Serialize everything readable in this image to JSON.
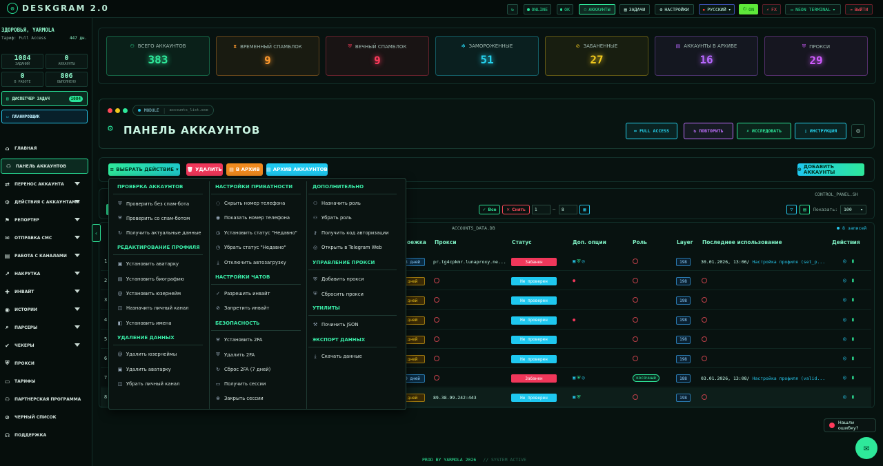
{
  "app": {
    "title": "DESKGRAM 2.0"
  },
  "topbar": {
    "refresh_icon": "refresh-icon",
    "online": "ONLINE",
    "ok": "OK",
    "accounts": "АККАУНТЫ",
    "tasks": "ЗАДАЧИ",
    "settings": "НАСТРОЙКИ",
    "language": "РУССКИЙ",
    "on": "ON",
    "fx": "FX",
    "theme": "NEON TERMINAL",
    "logout": "ВЫЙТИ"
  },
  "sidebar": {
    "greeting": "ЗДОРОВЬЯ, YARMOLA",
    "plan": "Тариф: Full Access",
    "days": "447 дн.",
    "stats": [
      {
        "value": "1084",
        "label": "ЗАДАНИЙ"
      },
      {
        "value": "0",
        "label": "АККАУНТЫ"
      },
      {
        "value": "0",
        "label": "В РАБОТЕ"
      },
      {
        "value": "806",
        "label": "ВЫПОЛНЕНО"
      }
    ],
    "dispatcher": "ДИСПЕТЧЕР ЗАДАЧ",
    "dispatcher_count": "1084",
    "planner": "ПЛАНИРОВЩИК",
    "nav": [
      {
        "label": "ГЛАВНАЯ",
        "icon": "home-icon",
        "glyph": "⌂"
      },
      {
        "label": "ПАНЕЛЬ АККАУНТОВ",
        "icon": "users-icon",
        "glyph": "⚇"
      },
      {
        "label": "ПЕРЕНОС АККАУНТА",
        "icon": "transfer-icon",
        "glyph": "⇄"
      },
      {
        "label": "ДЕЙСТВИЯ С АККАУНТАМИ",
        "icon": "user-gear-icon",
        "glyph": "⚙"
      },
      {
        "label": "РЕПОРТЕР",
        "icon": "flag-icon",
        "glyph": "⚑"
      },
      {
        "label": "ОТПРАВКА СМС",
        "icon": "chat-icon",
        "glyph": "✉"
      },
      {
        "label": "РАБОТА С КАНАЛАМИ",
        "icon": "channel-icon",
        "glyph": "▤"
      },
      {
        "label": "НАКРУТКА",
        "icon": "chart-icon",
        "glyph": "↗"
      },
      {
        "label": "ИНВАЙТ",
        "icon": "invite-icon",
        "glyph": "✚"
      },
      {
        "label": "ИСТОРИИ",
        "icon": "stories-icon",
        "glyph": "◉"
      },
      {
        "label": "ПАРСЕРЫ",
        "icon": "search-icon",
        "glyph": "⌕"
      },
      {
        "label": "ЧЕКЕРЫ",
        "icon": "check-icon",
        "glyph": "✔"
      },
      {
        "label": "ПРОКСИ",
        "icon": "shield-icon",
        "glyph": "⛨"
      },
      {
        "label": "ТАРИФЫ",
        "icon": "card-icon",
        "glyph": "▭"
      },
      {
        "label": "ПАРТНЕРСКАЯ ПРОГРАММА",
        "icon": "partner-icon",
        "glyph": "⚇"
      },
      {
        "label": "ЧЕРНЫЙ СПИСОК",
        "icon": "blacklist-icon",
        "glyph": "⊘"
      },
      {
        "label": "ПОДДЕРЖКА",
        "icon": "headset-icon",
        "glyph": "☊"
      }
    ]
  },
  "stats_cards": [
    {
      "label": "ВСЕГО АККАУНТОВ",
      "value": "383",
      "color": "#2ee89a",
      "icon": "users-icon",
      "glyph": "⚇"
    },
    {
      "label": "ВРЕМЕННЫЙ СПАМБЛОК",
      "value": "9",
      "color": "#ff9a2e",
      "icon": "hourglass-icon",
      "glyph": "⧗"
    },
    {
      "label": "ВЕЧНЫЙ СПАМБЛОК",
      "value": "9",
      "color": "#ff3b5c",
      "icon": "shield-icon",
      "glyph": "⛨"
    },
    {
      "label": "ЗАМОРОЖЕННЫЕ",
      "value": "51",
      "color": "#26d4f0",
      "icon": "snowflake-icon",
      "glyph": "✻"
    },
    {
      "label": "ЗАБАНЕННЫЕ",
      "value": "27",
      "color": "#f0c81e",
      "icon": "ban-icon",
      "glyph": "⊘"
    },
    {
      "label": "АККАУНТЫ В АРХИВЕ",
      "value": "16",
      "color": "#b768ff",
      "icon": "archive-icon",
      "glyph": "▤"
    },
    {
      "label": "ПРОКСИ",
      "value": "29",
      "color": "#d05cff",
      "icon": "proxy-icon",
      "glyph": "⛨"
    }
  ],
  "panel": {
    "module_label": "MODULE",
    "module_file": "accounts_list.exe",
    "title": "ПАНЕЛЬ АККАУНТОВ",
    "buttons": [
      {
        "label": "FULL ACCESS",
        "color": "#26d4f0",
        "icon": "infinity-icon",
        "glyph": "∞"
      },
      {
        "label": "ПОВТОРИТЬ",
        "color": "#c070ff",
        "icon": "repeat-icon",
        "glyph": "↻"
      },
      {
        "label": "ИССЛЕДОВАТЬ",
        "color": "#2ee89a",
        "icon": "research-icon",
        "glyph": "⌕"
      },
      {
        "label": "ИНСТРУКЦИЯ",
        "color": "#26d4f0",
        "icon": "book-icon",
        "glyph": "▯"
      }
    ]
  },
  "actions": {
    "select_action": "ВЫБРАТЬ ДЕЙСТВИЕ",
    "delete": "УДАЛИТЬ",
    "to_archive": "В АРХИВ",
    "archive_accounts": "АРХИВ АККАУНТОВ",
    "add_accounts": "ДОБАВИТЬ АККАУНТЫ"
  },
  "control": {
    "file": "CONTROL_PANEL.SH",
    "all": "Все",
    "reset": "Снять",
    "from": "1",
    "to": "8",
    "show_label": "Показать:",
    "show_value": "100"
  },
  "table": {
    "file": "ACCOUNTS_DATA.DB",
    "records": "8 записей",
    "headers": [
      "оежка",
      "Прокси",
      "Статус",
      "Доп. опции",
      "Роль",
      "Layer",
      "Последнее использование",
      "Действия"
    ],
    "rows": [
      {
        "num": "1",
        "dd": "8 дней",
        "dd_color": "blue",
        "proxy": "pr.tg4cpkmr.lunaproxy.ne...",
        "status": "Забанен",
        "status_color": "#f0375a",
        "opts": "camera,shield,check",
        "role": "",
        "layer": "198",
        "last": "30.01.2026, 13:06/",
        "last_link": "Настройка профиля (set_p..."
      },
      {
        "num": "2",
        "dd": "дней",
        "dd_color": "orange",
        "proxy": "",
        "status": "Не проверен",
        "status_color": "#1ec8f0",
        "opts": "f",
        "role": "",
        "layer": "198",
        "last": "",
        "last_link": ""
      },
      {
        "num": "3",
        "dd": "дней",
        "dd_color": "orange",
        "proxy": "",
        "status": "Не проверен",
        "status_color": "#1ec8f0",
        "opts": "",
        "role": "",
        "layer": "198",
        "last": "",
        "last_link": ""
      },
      {
        "num": "4",
        "dd": "дней",
        "dd_color": "orange",
        "proxy": "",
        "status": "Не проверен",
        "status_color": "#1ec8f0",
        "opts": "f",
        "role": "",
        "layer": "198",
        "last": "",
        "last_link": ""
      },
      {
        "num": "5",
        "dd": "дней",
        "dd_color": "orange",
        "proxy": "",
        "status": "Не проверен",
        "status_color": "#1ec8f0",
        "opts": "",
        "role": "",
        "layer": "198",
        "last": "",
        "last_link": ""
      },
      {
        "num": "6",
        "dd": "дней",
        "dd_color": "orange",
        "proxy": "",
        "status": "Не проверен",
        "status_color": "#1ec8f0",
        "opts": "",
        "role": "",
        "layer": "198",
        "last": "",
        "last_link": ""
      },
      {
        "num": "7",
        "dd": "0 дней",
        "dd_color": "blue",
        "proxy": "",
        "status": "Забанен",
        "status_color": "#f0375a",
        "opts": "camera,shield,check",
        "role": "косячный",
        "layer": "188",
        "last": "03.01.2026, 13:08/",
        "last_link": "Настройка профиля (valid..."
      },
      {
        "num": "8",
        "dd": "дней",
        "dd_color": "orange",
        "proxy": "89.38.99.242:443",
        "status": "Не проверен",
        "status_color": "#1ec8f0",
        "opts": "camera,shield",
        "role": "",
        "layer": "198",
        "last": "",
        "last_link": ""
      }
    ]
  },
  "dropdown": {
    "columns": [
      [
        {
          "type": "header",
          "label": "ПРОВЕРКА АККАУНТОВ"
        },
        {
          "type": "item",
          "label": "Проверить без спам-бота",
          "glyph": "⛨"
        },
        {
          "type": "item",
          "label": "Проверить со спам-ботом",
          "glyph": "⛨"
        },
        {
          "type": "item",
          "label": "Получить актуальные данные",
          "glyph": "↻"
        },
        {
          "type": "header",
          "label": "РЕДАКТИРОВАНИЕ ПРОФИЛЯ"
        },
        {
          "type": "item",
          "label": "Установить аватарку",
          "glyph": "▣"
        },
        {
          "type": "item",
          "label": "Установить биографию",
          "glyph": "▤"
        },
        {
          "type": "item",
          "label": "Установить юзернейм",
          "glyph": "@"
        },
        {
          "type": "item",
          "label": "Назначить личный канал",
          "glyph": "◫"
        },
        {
          "type": "item",
          "label": "Установить имена",
          "glyph": "◧"
        },
        {
          "type": "header",
          "label": "УДАЛЕНИЕ ДАННЫХ"
        },
        {
          "type": "item",
          "label": "Удалить юзернеймы",
          "glyph": "@"
        },
        {
          "type": "item",
          "label": "Удалить аватарку",
          "glyph": "▣"
        },
        {
          "type": "item",
          "label": "Убрать личный канал",
          "glyph": "◫"
        }
      ],
      [
        {
          "type": "header",
          "label": "НАСТРОЙКИ ПРИВАТНОСТИ"
        },
        {
          "type": "item",
          "label": "Скрыть номер телефона",
          "glyph": "◌"
        },
        {
          "type": "item",
          "label": "Показать номер телефона",
          "glyph": "◉"
        },
        {
          "type": "item",
          "label": "Установить статус \"Недавно\"",
          "glyph": "◷"
        },
        {
          "type": "item",
          "label": "Убрать статус \"Недавно\"",
          "glyph": "◷"
        },
        {
          "type": "item",
          "label": "Отключить автозагрузку",
          "glyph": "⤓"
        },
        {
          "type": "header",
          "label": "НАСТРОЙКИ ЧАТОВ"
        },
        {
          "type": "item",
          "label": "Разрешить инвайт",
          "glyph": "✓"
        },
        {
          "type": "item",
          "label": "Запретить инвайт",
          "glyph": "⊘"
        },
        {
          "type": "header",
          "label": "БЕЗОПАСНОСТЬ"
        },
        {
          "type": "item",
          "label": "Установить 2FA",
          "glyph": "⛨"
        },
        {
          "type": "item",
          "label": "Удалить 2FA",
          "glyph": "⛨"
        },
        {
          "type": "item",
          "label": "Сброс 2FA (7 дней)",
          "glyph": "↻"
        },
        {
          "type": "item",
          "label": "Получить сессии",
          "glyph": "▭"
        },
        {
          "type": "item",
          "label": "Закрыть сессии",
          "glyph": "⊗"
        }
      ],
      [
        {
          "type": "header",
          "label": "ДОПОЛНИТЕЛЬНО"
        },
        {
          "type": "item",
          "label": "Назначить роль",
          "glyph": "⚇"
        },
        {
          "type": "item",
          "label": "Убрать роль",
          "glyph": "⚇"
        },
        {
          "type": "item",
          "label": "Получить код авторизации",
          "glyph": "⚷"
        },
        {
          "type": "item",
          "label": "Открыть в Telegram Web",
          "glyph": "◎"
        },
        {
          "type": "header",
          "label": "УПРАВЛЕНИЕ ПРОКСИ"
        },
        {
          "type": "item",
          "label": "Добавить прокси",
          "glyph": "⛨"
        },
        {
          "type": "item",
          "label": "Сбросить прокси",
          "glyph": "⛨"
        },
        {
          "type": "header",
          "label": "УТИЛИТЫ"
        },
        {
          "type": "item",
          "label": "Починить JSON",
          "glyph": "⚒"
        },
        {
          "type": "header",
          "label": "ЭКСПОРТ ДАННЫХ"
        },
        {
          "type": "item",
          "label": "Скачать данные",
          "glyph": "⤓"
        }
      ]
    ]
  },
  "footer": {
    "text": "PROD BY YARMOLA 2026",
    "status": "// SYSTEM ACTIVE"
  },
  "bug_report": "Нашли ошибку?"
}
